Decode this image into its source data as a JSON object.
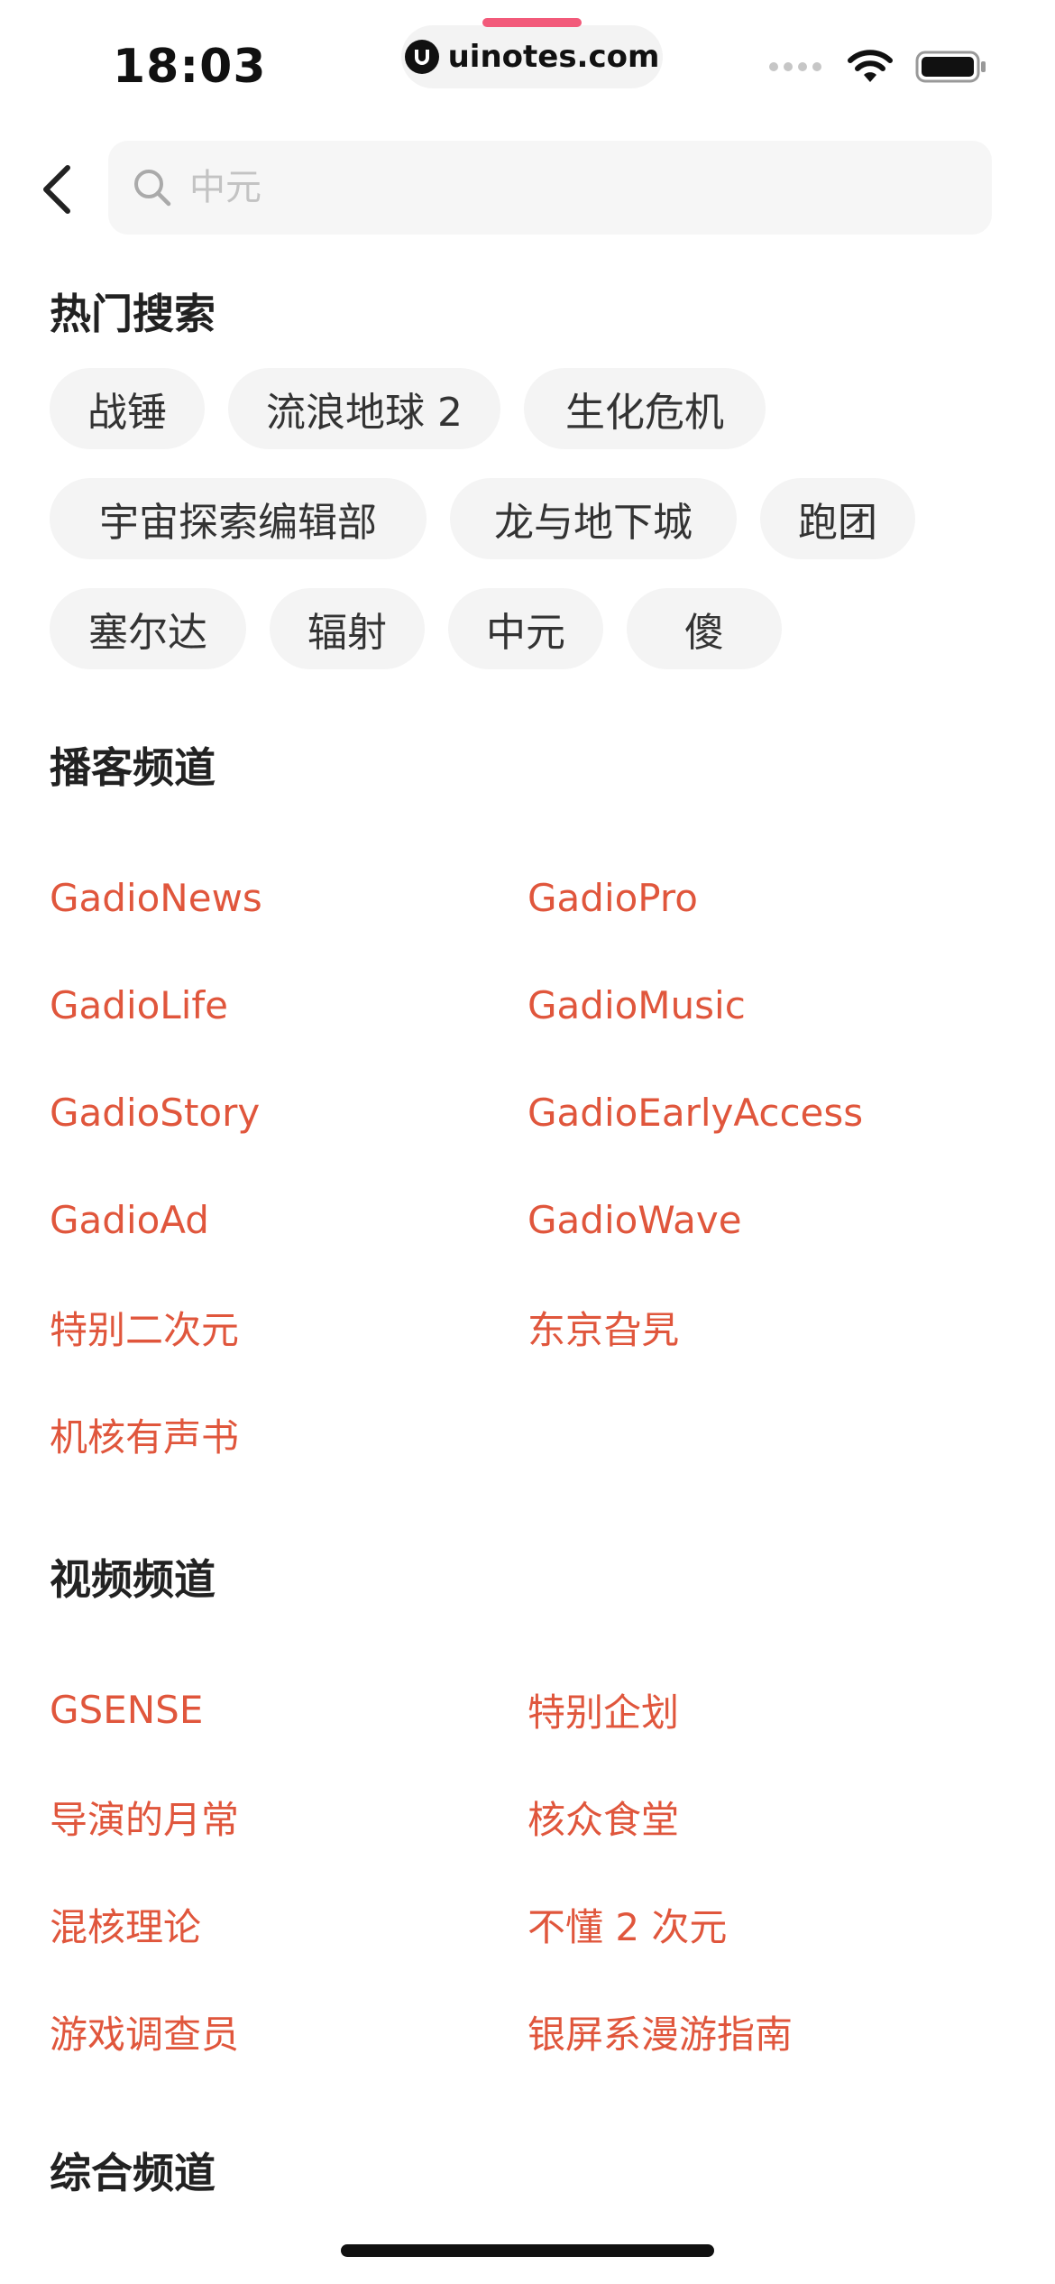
{
  "status_bar": {
    "time": "18:03",
    "url": "uinotes.com"
  },
  "search": {
    "placeholder": "中元"
  },
  "hot_search": {
    "title": "热门搜索",
    "rows": [
      [
        "战锤",
        "流浪地球 2",
        "生化危机"
      ],
      [
        "宇宙探索编辑部",
        "龙与地下城",
        "跑团"
      ],
      [
        "塞尔达",
        "辐射",
        "中元",
        "傻"
      ]
    ]
  },
  "podcast_channels": {
    "title": "播客频道",
    "items": [
      "GadioNews",
      "GadioPro",
      "GadioLife",
      "GadioMusic",
      "GadioStory",
      "GadioEarlyAccess",
      "GadioAd",
      "GadioWave",
      "特别二次元",
      "东京旮旯",
      "机核有声书"
    ]
  },
  "video_channels": {
    "title": "视频频道",
    "items": [
      "GSENSE",
      "特别企划",
      "导演的月常",
      "核众食堂",
      "混核理论",
      "不懂 2 次元",
      "游戏调查员",
      "银屏系漫游指南"
    ]
  },
  "general_channels": {
    "title": "综合频道"
  },
  "colors": {
    "accent": "#e0563c",
    "tag_bg": "#f4f4f4",
    "search_bg": "#f6f6f6"
  }
}
